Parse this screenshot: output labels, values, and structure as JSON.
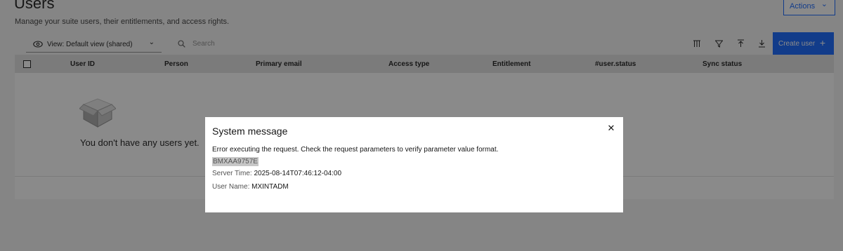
{
  "header": {
    "title": "Users",
    "subtitle": "Manage your suite users, their entitlements, and access rights.",
    "actions_label": "Actions"
  },
  "toolbar": {
    "view_label": "View: Default view (shared)",
    "search_placeholder": "Search",
    "create_label": "Create user",
    "icons": [
      "columns-icon",
      "filter-icon",
      "upload-icon",
      "download-icon"
    ]
  },
  "table": {
    "columns": [
      "User ID",
      "Person",
      "Primary email",
      "Access type",
      "Entitlement",
      "#user.status",
      "Sync status"
    ],
    "empty_message": "You don't have any users yet."
  },
  "modal": {
    "title": "System message",
    "message": "Error executing the request. Check the request parameters to verify parameter value format.",
    "error_code": "BMXAA9757E",
    "server_time_label": "Server Time:",
    "server_time_value": "2025-08-14T07:46:12-04:00",
    "user_name_label": "User Name:",
    "user_name_value": "MXINTADM"
  },
  "colors": {
    "accent": "#0f62fe",
    "overlay": "#161616"
  }
}
